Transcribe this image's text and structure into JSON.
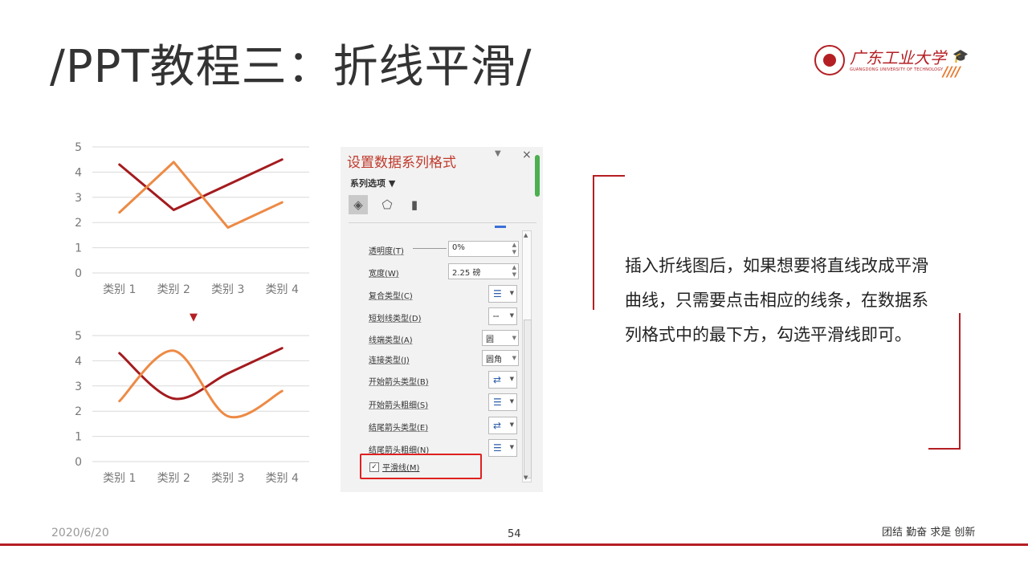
{
  "title": "/PPT教程三：折线平滑/",
  "logo": {
    "name": "广东工业大学",
    "sub": "GUANGDONG UNIVERSITY OF TECHNOLOGY"
  },
  "chart_data": [
    {
      "type": "line",
      "categories": [
        "类别 1",
        "类别 2",
        "类别 3",
        "类别 4"
      ],
      "yticks": [
        "0",
        "1",
        "2",
        "3",
        "4",
        "5"
      ],
      "ylim": [
        0,
        5
      ],
      "smooth": false,
      "grid": true,
      "series": [
        {
          "values": [
            4.3,
            2.5,
            3.5,
            4.5
          ],
          "color": "#a31b1e"
        },
        {
          "values": [
            2.4,
            4.4,
            1.8,
            2.8
          ],
          "color": "#ed8a45"
        }
      ]
    },
    {
      "type": "line",
      "categories": [
        "类别 1",
        "类别 2",
        "类别 3",
        "类别 4"
      ],
      "yticks": [
        "0",
        "1",
        "2",
        "3",
        "4",
        "5"
      ],
      "ylim": [
        0,
        5
      ],
      "smooth": true,
      "grid": true,
      "series": [
        {
          "values": [
            4.3,
            2.5,
            3.5,
            4.5
          ],
          "color": "#a31b1e"
        },
        {
          "values": [
            2.4,
            4.4,
            1.8,
            2.8
          ],
          "color": "#ed8a45"
        }
      ]
    }
  ],
  "arrow": "▼",
  "panel": {
    "title": "设置数据系列格式",
    "series_options": "系列选项 ▼",
    "rows": {
      "transparency": {
        "label": "透明度(T)",
        "value": "0%"
      },
      "width": {
        "label": "宽度(W)",
        "value": "2.25 磅"
      },
      "compound": {
        "label": "复合类型(C)"
      },
      "dash": {
        "label": "短划线类型(D)"
      },
      "cap": {
        "label": "线端类型(A)",
        "value": "圆"
      },
      "join": {
        "label": "连接类型(J)",
        "value": "圆角"
      },
      "begin_arrow_type": {
        "label": "开始箭头类型(B)"
      },
      "begin_arrow_size": {
        "label": "开始箭头粗细(S)"
      },
      "end_arrow_type": {
        "label": "结尾箭头类型(E)"
      },
      "end_arrow_size": {
        "label": "结尾箭头粗细(N)"
      }
    },
    "smooth": {
      "label": "平滑线(M)",
      "checked": true
    }
  },
  "description": "插入折线图后，如果想要将直线改成平滑曲线，只需要点击相应的线条，在数据系列格式中的最下方，勾选平滑线即可。",
  "footer": {
    "date": "2020/6/20",
    "page": "54",
    "motto": "团结 勤奋 求是 创新"
  }
}
